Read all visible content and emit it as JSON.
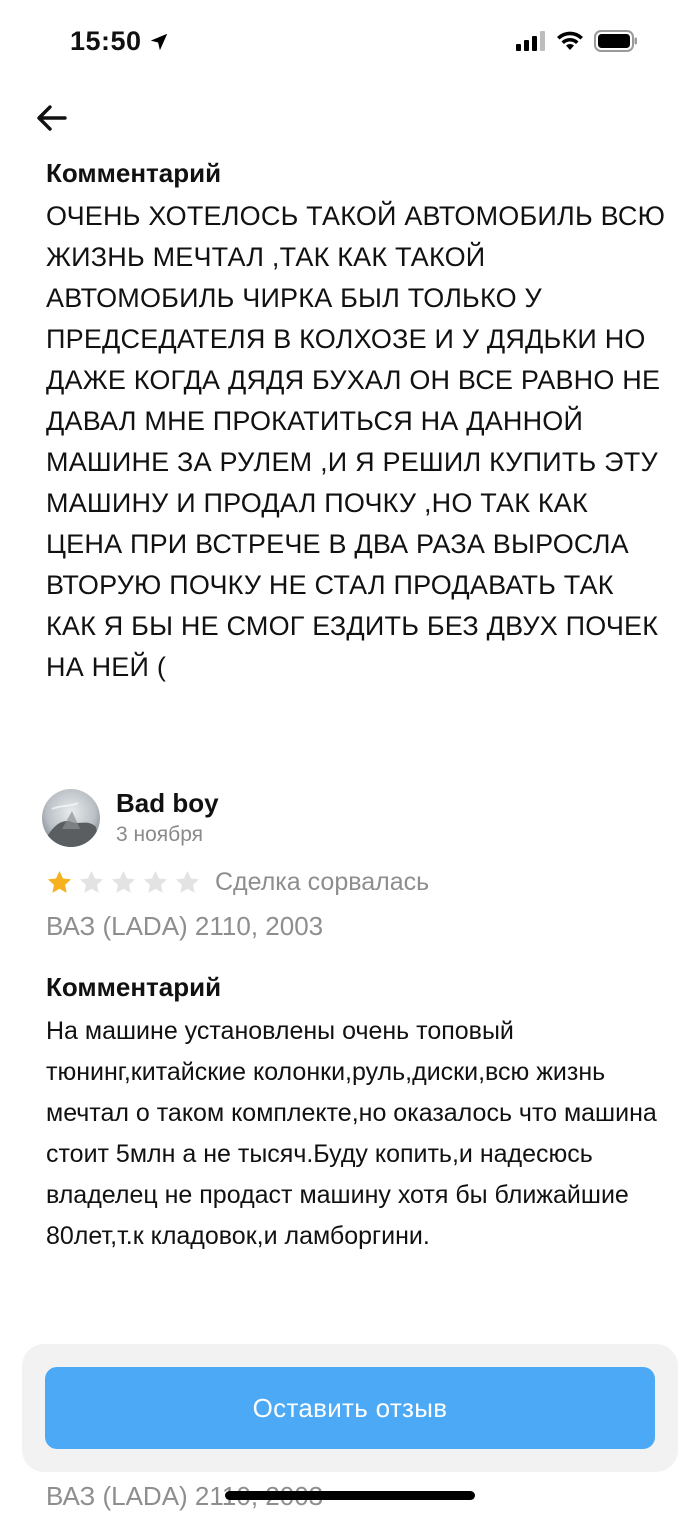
{
  "status_bar": {
    "time": "15:50",
    "icons": [
      "location-arrow-icon",
      "cellular-signal-icon",
      "wifi-icon",
      "battery-icon"
    ]
  },
  "nav": {
    "back_icon": "arrow-left-icon"
  },
  "previous_review": {
    "comment_title": "Комментарий",
    "comment_text": "ОЧЕНЬ ХОТЕЛОСЬ ТАКОЙ АВТОМОБИЛЬ ВСЮ ЖИЗНЬ МЕЧТАЛ ,ТАК КАК ТАКОЙ АВТОМОБИЛЬ ЧИРКА БЫЛ ТОЛЬКО У ПРЕДСЕДАТЕЛЯ В КОЛХОЗЕ И У ДЯДЬКИ НО ДАЖЕ КОГДА ДЯДЯ БУХАЛ ОН ВСЕ РАВНО НЕ ДАВАЛ МНЕ ПРОКАТИТЬСЯ НА ДАННОЙ МАШИНЕ ЗА РУЛЕМ ,И Я РЕШИЛ КУПИТЬ ЭТУ МАШИНУ И ПРОДАЛ ПОЧКУ ,НО ТАК КАК ЦЕНА ПРИ ВСТРЕЧЕ В ДВА РАЗА ВЫРОСЛА ВТОРУЮ ПОЧКУ НЕ СТАЛ ПРОДАВАТЬ ТАК КАК Я БЫ НЕ СМОГ ЕЗДИТЬ БЕЗ ДВУХ ПОЧЕК НА НЕЙ ("
  },
  "review": {
    "author": "Bad boy",
    "date": "3 ноября",
    "rating": 1,
    "rating_max": 5,
    "deal_status": "Сделка сорвалась",
    "car_model": "ВАЗ (LADA) 2110, 2003",
    "comment_title": "Комментарий",
    "comment_text": "На машине установлены очень топовый тюнинг,китайские колонки,руль,диски,всю жизнь мечтал о таком комплекте,но оказалось что машина стоит 5млн а не тысяч.Буду копить,и надесюсь владелец не продаст машину хотя бы ближайшие 80лет,т.к кладовок,и ламборгини."
  },
  "footer": {
    "leave_review_label": "Оставить отзыв"
  },
  "next_review_peek": {
    "car_model": "ВАЗ (LADA) 2110, 2003"
  },
  "colors": {
    "accent": "#4ba9f5",
    "star_filled": "#f5b11f",
    "star_empty": "#e3e3e3",
    "muted_text": "#8e8e8e"
  }
}
